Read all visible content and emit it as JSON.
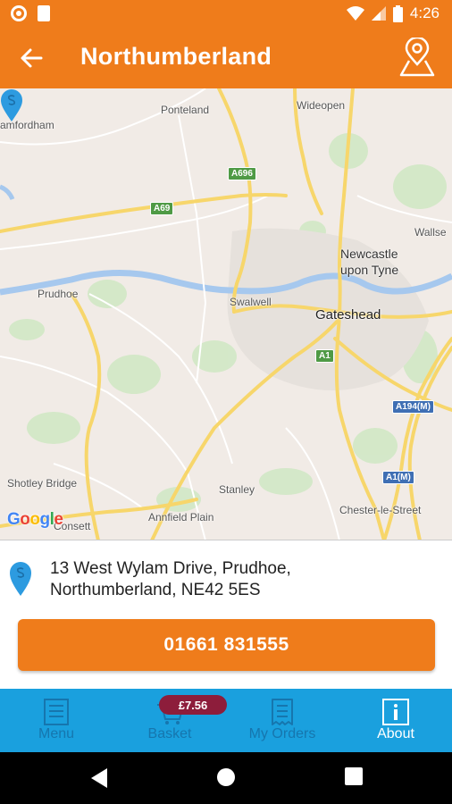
{
  "status_bar": {
    "time": "4:26"
  },
  "app_bar": {
    "title": "Northumberland"
  },
  "map": {
    "labels": {
      "ponteland": "Ponteland",
      "wideopen": "Wideopen",
      "stamfordham": "amfordham",
      "wallsend": "Wallse",
      "newcastle_line1": "Newcastle",
      "newcastle_line2": "upon Tyne",
      "prudhoe": "Prudhoe",
      "swalwell": "Swalwell",
      "gateshead": "Gateshead",
      "shotley_bridge": "Shotley Bridge",
      "stanley": "Stanley",
      "annfield_plain": "Annfield Plain",
      "chester_le_street": "Chester-le-Street",
      "consett": "Consett",
      "google": "Google"
    },
    "roads": {
      "a696": "A696",
      "a69": "A69",
      "a1": "A1",
      "a194m": "A194(M)",
      "a1m": "A1(M)"
    }
  },
  "address": {
    "line1": "13 West Wylam Drive, Prudhoe,",
    "line2": "Northumberland, NE42 5ES"
  },
  "call_button": {
    "label": "01661 831555"
  },
  "tabs": [
    {
      "label": "Menu",
      "icon": "menu-icon"
    },
    {
      "label": "Basket",
      "icon": "basket-icon",
      "badge": "£7.56"
    },
    {
      "label": "My Orders",
      "icon": "receipt-icon"
    },
    {
      "label": "About",
      "icon": "info-icon",
      "active": true
    }
  ],
  "colors": {
    "accent": "#ef7c1b",
    "tabbar": "#1aa0de",
    "badge": "#8d1d3b"
  }
}
